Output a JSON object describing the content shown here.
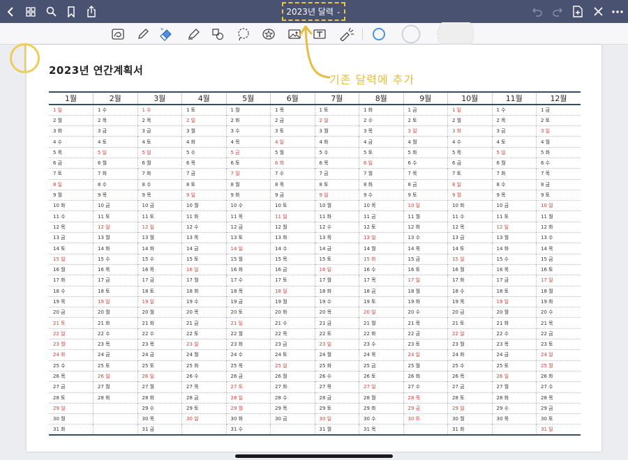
{
  "topbar": {
    "title": "2023년 달력",
    "title_chevron": "⌄",
    "left_icons": [
      "back-icon",
      "grid-icon",
      "search-icon",
      "bookmark-icon",
      "share-icon"
    ],
    "right_icons": [
      "undo-icon",
      "redo-icon",
      "add-page-icon",
      "close-icon",
      "more-icon"
    ]
  },
  "toolbar": {
    "tools": [
      "lasso-image-icon",
      "pen-icon",
      "eraser-icon",
      "highlighter-icon",
      "shapes-icon",
      "lasso-icon",
      "sticker-icon",
      "image-icon",
      "text-box-icon",
      "laser-pointer-icon"
    ],
    "colors": [
      "#4d8fe0",
      "#d0d2d6",
      "#e8e8ea"
    ]
  },
  "document": {
    "title": "2023년  연간계획서",
    "annotation": "기존 달력에 추가",
    "months": [
      "1월",
      "2월",
      "3월",
      "4월",
      "5월",
      "6월",
      "7월",
      "8월",
      "9월",
      "10월",
      "11월",
      "12월"
    ],
    "rows": [
      [
        "1 일",
        "1 수",
        "1 수",
        "1 토",
        "1 월",
        "1 목",
        "1 토",
        "1 화",
        "1 금",
        "1 일",
        "1 수",
        "1 금"
      ],
      [
        "2 월",
        "2 목",
        "2 목",
        "2 일",
        "2 화",
        "2 금",
        "2 일",
        "2 수",
        "2 토",
        "2 월",
        "2 목",
        "2 토"
      ],
      [
        "3 화",
        "3 금",
        "3 금",
        "3 월",
        "3 수",
        "3 토",
        "3 월",
        "3 목",
        "3 일",
        "3 화",
        "3 금",
        "3 일"
      ],
      [
        "4 수",
        "4 토",
        "4 토",
        "4 화",
        "4 목",
        "4 일",
        "4 화",
        "4 금",
        "4 월",
        "4 수",
        "4 토",
        "4 월"
      ],
      [
        "5 목",
        "5 일",
        "5 일",
        "5 수",
        "5 금",
        "5 월",
        "5 수",
        "5 토",
        "5 화",
        "5 목",
        "5 일",
        "5 화"
      ],
      [
        "6 금",
        "6 월",
        "6 월",
        "6 목",
        "6 토",
        "6 화",
        "6 목",
        "6 일",
        "6 수",
        "6 금",
        "6 월",
        "6 수"
      ],
      [
        "7 토",
        "7 화",
        "7 화",
        "7 금",
        "7 일",
        "7 수",
        "7 금",
        "7 월",
        "7 목",
        "7 토",
        "7 화",
        "7 목"
      ],
      [
        "8 일",
        "8 수",
        "8 수",
        "8 토",
        "8 월",
        "8 목",
        "8 토",
        "8 화",
        "8 금",
        "8 일",
        "8 수",
        "8 금"
      ],
      [
        "9 월",
        "9 목",
        "9 목",
        "9 일",
        "9 화",
        "9 금",
        "9 일",
        "9 수",
        "9 토",
        "9 월",
        "9 목",
        "9 토"
      ],
      [
        "10 화",
        "10 금",
        "10 금",
        "10 월",
        "10 수",
        "10 토",
        "10 월",
        "10 목",
        "10 일",
        "10 화",
        "10 금",
        "10 일"
      ],
      [
        "11 수",
        "11 토",
        "11 토",
        "11 화",
        "11 목",
        "11 일",
        "11 화",
        "11 금",
        "11 월",
        "11 수",
        "11 토",
        "11 월"
      ],
      [
        "12 목",
        "12 일",
        "12 일",
        "12 수",
        "12 금",
        "12 월",
        "12 수",
        "12 토",
        "12 화",
        "12 목",
        "12 일",
        "12 화"
      ],
      [
        "13 금",
        "13 월",
        "13 월",
        "13 목",
        "13 토",
        "13 화",
        "13 목",
        "13 일",
        "13 수",
        "13 금",
        "13 월",
        "13 수"
      ],
      [
        "14 토",
        "14 화",
        "14 화",
        "14 금",
        "14 일",
        "14 수",
        "14 금",
        "14 월",
        "14 목",
        "14 토",
        "14 화",
        "14 목"
      ],
      [
        "15 일",
        "15 수",
        "15 수",
        "15 토",
        "15 월",
        "15 목",
        "15 토",
        "15 화",
        "15 금",
        "15 일",
        "15 수",
        "15 금"
      ],
      [
        "16 월",
        "16 목",
        "16 목",
        "16 일",
        "16 화",
        "16 금",
        "16 일",
        "16 수",
        "16 토",
        "16 월",
        "16 목",
        "16 토"
      ],
      [
        "17 화",
        "17 금",
        "17 금",
        "17 월",
        "17 수",
        "17 토",
        "17 월",
        "17 목",
        "17 일",
        "17 화",
        "17 금",
        "17 일"
      ],
      [
        "18 수",
        "18 토",
        "18 토",
        "18 화",
        "18 목",
        "18 일",
        "18 화",
        "18 금",
        "18 월",
        "18 수",
        "18 토",
        "18 월"
      ],
      [
        "19 목",
        "19 일",
        "19 일",
        "19 수",
        "19 금",
        "19 월",
        "19 수",
        "19 토",
        "19 화",
        "19 목",
        "19 일",
        "19 화"
      ],
      [
        "20 금",
        "20 월",
        "20 월",
        "20 목",
        "20 토",
        "20 화",
        "20 목",
        "20 일",
        "20 수",
        "20 금",
        "20 월",
        "20 수"
      ],
      [
        "21 토",
        "21 화",
        "21 화",
        "21 금",
        "21 일",
        "21 수",
        "21 금",
        "21 월",
        "21 목",
        "21 토",
        "21 화",
        "21 목"
      ],
      [
        "22 일",
        "22 수",
        "22 수",
        "22 토",
        "22 월",
        "22 목",
        "22 토",
        "22 화",
        "22 금",
        "22 일",
        "22 수",
        "22 금"
      ],
      [
        "23 월",
        "23 목",
        "23 목",
        "23 일",
        "23 화",
        "23 금",
        "23 일",
        "23 수",
        "23 토",
        "23 월",
        "23 목",
        "23 토"
      ],
      [
        "24 화",
        "24 금",
        "24 금",
        "24 월",
        "24 수",
        "24 토",
        "24 월",
        "24 목",
        "24 일",
        "24 화",
        "24 금",
        "24 일"
      ],
      [
        "25 수",
        "25 토",
        "25 토",
        "25 화",
        "25 목",
        "25 일",
        "25 화",
        "25 금",
        "25 월",
        "25 수",
        "25 토",
        "25 월"
      ],
      [
        "26 목",
        "26 일",
        "26 일",
        "26 수",
        "26 금",
        "26 월",
        "26 수",
        "26 토",
        "26 화",
        "26 목",
        "26 일",
        "26 화"
      ],
      [
        "27 금",
        "27 월",
        "27 월",
        "27 목",
        "27 토",
        "27 화",
        "27 목",
        "27 일",
        "27 수",
        "27 금",
        "27 월",
        "27 수"
      ],
      [
        "28 토",
        "28 화",
        "28 화",
        "28 금",
        "28 일",
        "28 수",
        "28 금",
        "28 월",
        "28 목",
        "28 토",
        "28 화",
        "28 목"
      ],
      [
        "29 일",
        "",
        "29 수",
        "29 토",
        "29 월",
        "29 목",
        "29 토",
        "29 화",
        "29 금",
        "29 일",
        "29 수",
        "29 금"
      ],
      [
        "30 월",
        "",
        "30 목",
        "30 일",
        "30 화",
        "30 금",
        "30 일",
        "30 수",
        "30 토",
        "30 월",
        "30 목",
        "30 토"
      ],
      [
        "31 화",
        "",
        "31 금",
        "",
        "31 수",
        "",
        "31 월",
        "31 목",
        "",
        "31 화",
        "",
        "31 일"
      ]
    ],
    "red_days": [
      "일"
    ],
    "red_dates": [
      "1-1",
      "1-21",
      "1-22",
      "1-23",
      "1-24",
      "3-1",
      "5-5",
      "5-27",
      "5-29",
      "6-6",
      "8-15",
      "9-28",
      "9-29",
      "9-30",
      "10-3",
      "10-9",
      "12-25"
    ]
  },
  "colors": {
    "topbar_bg": "#4a5272",
    "highlight": "#e8c84a",
    "holiday_red": "#d6403a",
    "table_rule": "#2f4d63"
  }
}
